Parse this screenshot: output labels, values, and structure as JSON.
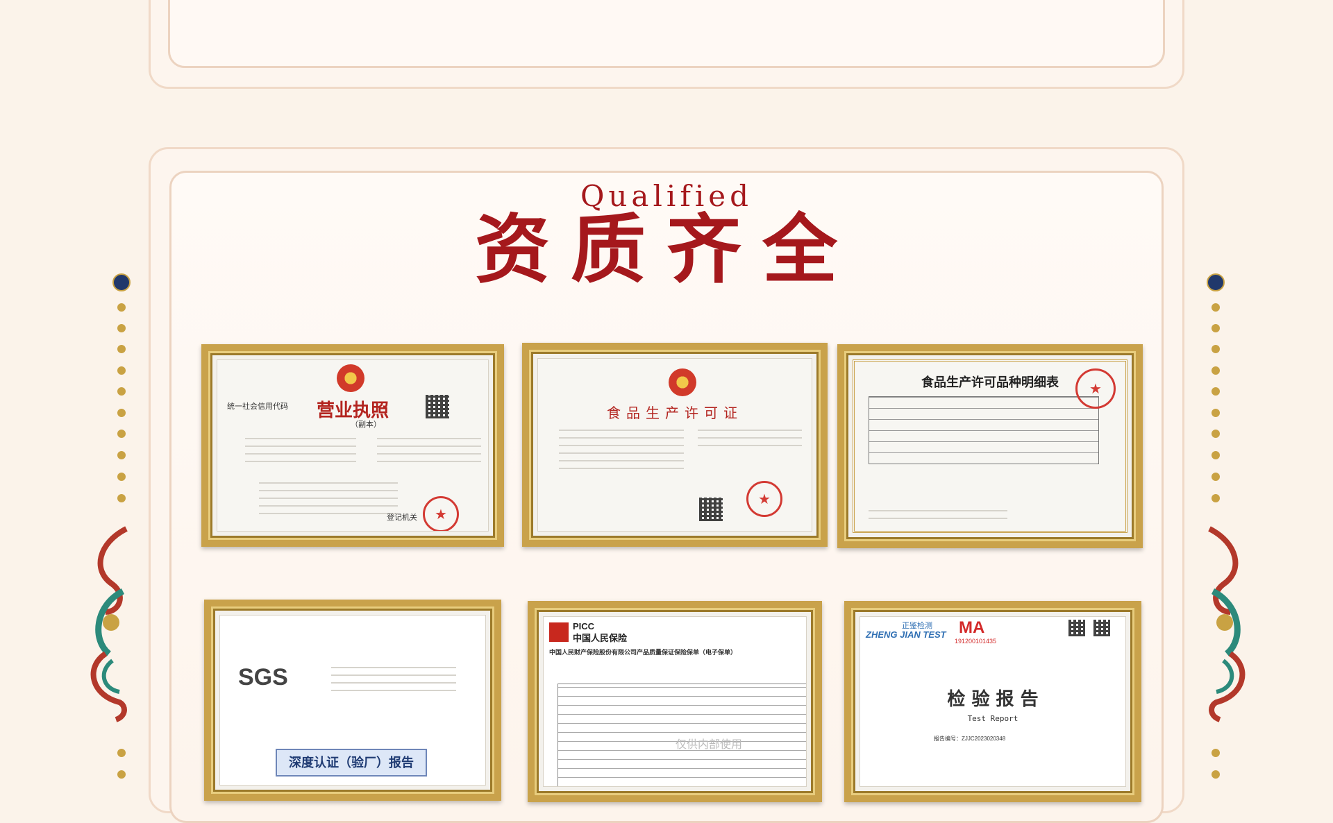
{
  "section": {
    "title_en": "Qualified",
    "title_cn": "资质齐全"
  },
  "certificates": [
    {
      "name": "business-license",
      "title": "营业执照",
      "subtitle": "（副本）",
      "label": "统一社会信用代码",
      "seal_text": "登记机关"
    },
    {
      "name": "food-production-license",
      "title": "食品生产许可证"
    },
    {
      "name": "food-production-license-details",
      "title": "食品生产许可品种明细表"
    },
    {
      "name": "sgs-report",
      "logo": "SGS",
      "caption": "深度认证（验厂）报告"
    },
    {
      "name": "picc-insurance",
      "logo_en": "PICC",
      "logo_cn": "中国人民保险",
      "heading": "中国人民财产保险股份有限公司产品质量保证保险保单（电子保单）",
      "watermark": "仅供内部使用"
    },
    {
      "name": "test-report",
      "brand": "ZHENG JIAN TEST",
      "brand_cn": "正鉴检测",
      "cma": "MA",
      "cma_no": "191200101435",
      "title": "检 验 报 告",
      "subtitle": "Test   Report",
      "report_no": "报告编号：ZJJC2023020348"
    }
  ],
  "colors": {
    "accent": "#a5181c",
    "gold": "#c9a24b",
    "navy": "#21386b",
    "background": "#fbf3ea"
  }
}
